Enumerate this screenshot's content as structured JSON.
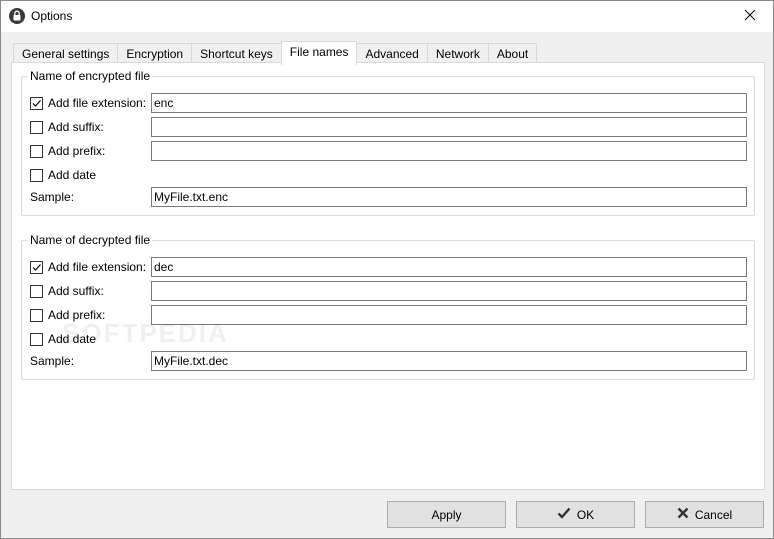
{
  "window": {
    "title": "Options"
  },
  "tabs": [
    {
      "label": "General settings",
      "active": false
    },
    {
      "label": "Encryption",
      "active": false
    },
    {
      "label": "Shortcut keys",
      "active": false
    },
    {
      "label": "File names",
      "active": true
    },
    {
      "label": "Advanced",
      "active": false
    },
    {
      "label": "Network",
      "active": false
    },
    {
      "label": "About",
      "active": false
    }
  ],
  "encrypted": {
    "title": "Name of encrypted file",
    "extension": {
      "label": "Add file extension:",
      "checked": true,
      "value": "enc"
    },
    "suffix": {
      "label": "Add suffix:",
      "checked": false,
      "value": ""
    },
    "prefix": {
      "label": "Add prefix:",
      "checked": false,
      "value": ""
    },
    "date": {
      "label": "Add date",
      "checked": false
    },
    "sample": {
      "label": "Sample:",
      "value": "MyFile.txt.enc"
    }
  },
  "decrypted": {
    "title": "Name of decrypted file",
    "extension": {
      "label": "Add file extension:",
      "checked": true,
      "value": "dec"
    },
    "suffix": {
      "label": "Add suffix:",
      "checked": false,
      "value": ""
    },
    "prefix": {
      "label": "Add prefix:",
      "checked": false,
      "value": ""
    },
    "date": {
      "label": "Add date",
      "checked": false
    },
    "sample": {
      "label": "Sample:",
      "value": "MyFile.txt.dec"
    }
  },
  "buttons": {
    "apply": "Apply",
    "ok": "OK",
    "cancel": "Cancel"
  },
  "watermark": "SOFTPEDIA",
  "icons": {
    "title": "lock-icon",
    "close": "close-icon",
    "ok": "checkmark-icon",
    "cancel": "x-icon"
  }
}
